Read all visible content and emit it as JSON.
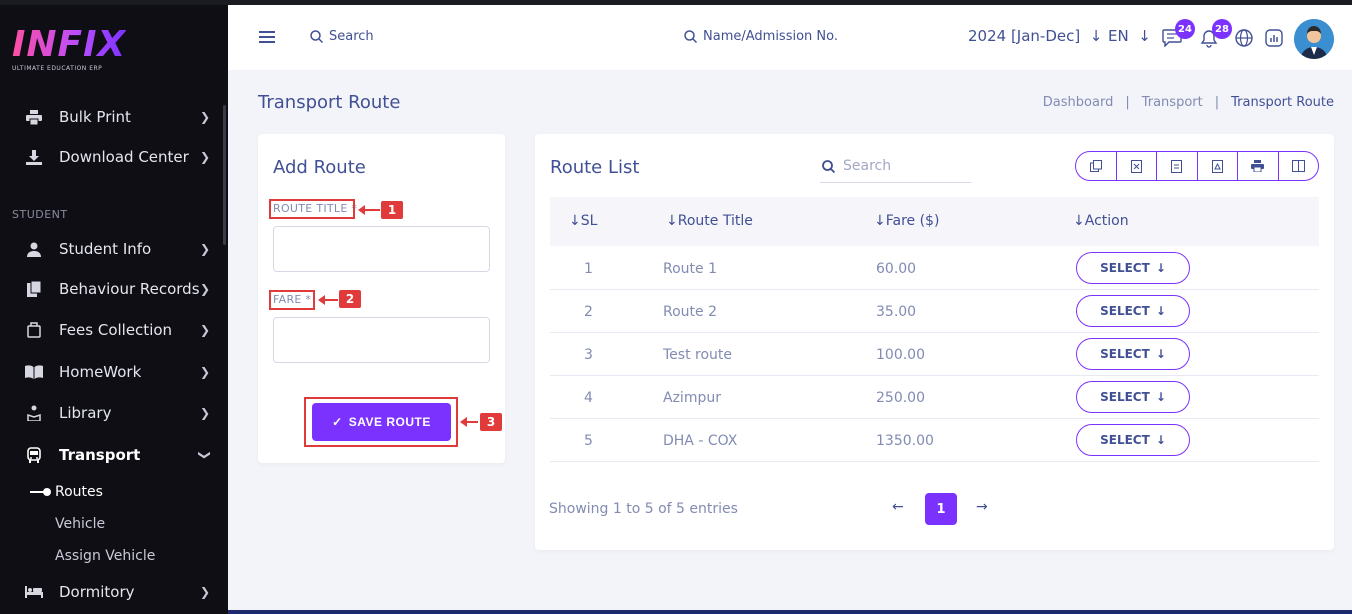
{
  "logo": {
    "text": "INFIX",
    "subtitle": "ULTIMATE EDUCATION ERP"
  },
  "sidebar": {
    "items_top": [
      {
        "label": "Bulk Print",
        "icon": "printer-icon"
      },
      {
        "label": "Download Center",
        "icon": "download-icon"
      }
    ],
    "section_student": "STUDENT",
    "items": [
      {
        "label": "Student Info",
        "icon": "student-icon"
      },
      {
        "label": "Behaviour Records",
        "icon": "records-icon"
      },
      {
        "label": "Fees Collection",
        "icon": "fees-icon"
      },
      {
        "label": "HomeWork",
        "icon": "book-icon"
      },
      {
        "label": "Library",
        "icon": "library-icon"
      },
      {
        "label": "Transport",
        "icon": "bus-icon"
      }
    ],
    "transport_sub": [
      "Routes",
      "Vehicle",
      "Assign Vehicle"
    ],
    "dormitory": {
      "label": "Dormitory",
      "icon": "bed-icon"
    }
  },
  "header": {
    "search_label": "Search",
    "name_search_label": "Name/Admission No.",
    "session": "2024 [Jan-Dec]",
    "language": "EN",
    "messages_count": "24",
    "notifications_count": "28"
  },
  "page": {
    "title": "Transport Route",
    "breadcrumb": [
      "Dashboard",
      "Transport",
      "Transport Route"
    ]
  },
  "add_route": {
    "title": "Add Route",
    "route_title_label": "ROUTE TITLE *",
    "fare_label": "FARE *",
    "route_title_value": "",
    "fare_value": "",
    "save_label": "SAVE ROUTE"
  },
  "annotations": [
    "1",
    "2",
    "3"
  ],
  "route_list": {
    "title": "Route List",
    "search_placeholder": "Search",
    "columns": [
      "SL",
      "Route Title",
      "Fare ($)",
      "Action"
    ],
    "rows": [
      {
        "sl": "1",
        "title": "Route 1",
        "fare": "60.00",
        "action": "SELECT"
      },
      {
        "sl": "2",
        "title": "Route 2",
        "fare": "35.00",
        "action": "SELECT"
      },
      {
        "sl": "3",
        "title": "Test route",
        "fare": "100.00",
        "action": "SELECT"
      },
      {
        "sl": "4",
        "title": "Azimpur",
        "fare": "250.00",
        "action": "SELECT"
      },
      {
        "sl": "5",
        "title": "DHA - COX",
        "fare": "1350.00",
        "action": "SELECT"
      }
    ],
    "showing": "Showing 1 to 5 of 5 entries",
    "page": "1",
    "export_icons": [
      "copy-icon",
      "excel-icon",
      "csv-icon",
      "pdf-icon",
      "print-icon",
      "columns-icon"
    ]
  },
  "colors": {
    "accent": "#7c32ff",
    "text": "#415094",
    "annotation": "#e03a3a",
    "sidebar": "#0e0e14"
  }
}
